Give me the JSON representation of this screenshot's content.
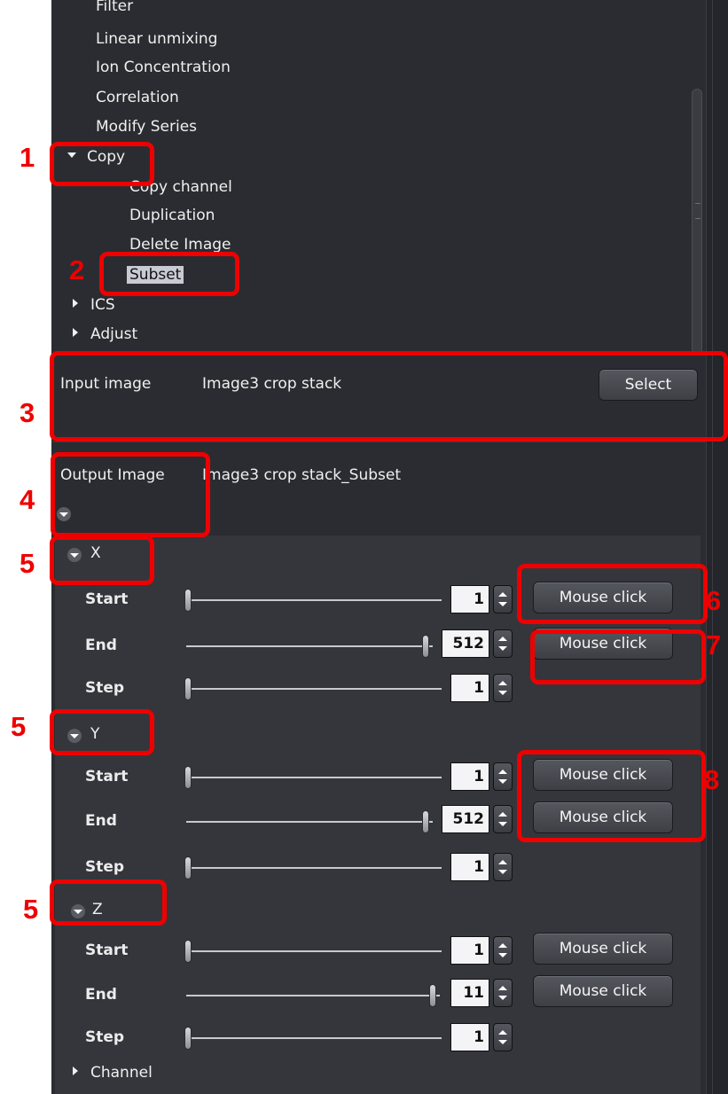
{
  "tree": {
    "items": [
      {
        "label": "Filter"
      },
      {
        "label": "Linear unmixing"
      },
      {
        "label": "Ion Concentration"
      },
      {
        "label": "Correlation"
      },
      {
        "label": "Modify Series"
      },
      {
        "label": "Copy"
      },
      {
        "label": "Copy channel"
      },
      {
        "label": "Duplication"
      },
      {
        "label": "Delete Image"
      },
      {
        "label": "Subset"
      },
      {
        "label": "ICS"
      },
      {
        "label": "Adjust"
      }
    ]
  },
  "input": {
    "label": "Input image",
    "value": "Image3 crop stack",
    "button": "Select"
  },
  "output": {
    "label": "Output Image",
    "value": "Image3 crop stack_Subset"
  },
  "axes": [
    {
      "name": "X",
      "rows": [
        {
          "label": "Start",
          "value": "1",
          "button": "Mouse click"
        },
        {
          "label": "End",
          "value": "512",
          "button": "Mouse click"
        },
        {
          "label": "Step",
          "value": "1"
        }
      ]
    },
    {
      "name": "Y",
      "rows": [
        {
          "label": "Start",
          "value": "1",
          "button": "Mouse click"
        },
        {
          "label": "End",
          "value": "512",
          "button": "Mouse click"
        },
        {
          "label": "Step",
          "value": "1"
        }
      ]
    },
    {
      "name": "Z",
      "rows": [
        {
          "label": "Start",
          "value": "1",
          "button": "Mouse click"
        },
        {
          "label": "End",
          "value": "11",
          "button": "Mouse click"
        },
        {
          "label": "Step",
          "value": "1"
        }
      ]
    }
  ],
  "channel": {
    "label": "Channel"
  },
  "annotations": [
    "1",
    "2",
    "3",
    "4",
    "5",
    "5",
    "5",
    "6",
    "7",
    "8"
  ],
  "colors": {
    "annotation": "#ee0000",
    "panel": "#2b2c31",
    "section": "#35363c"
  }
}
